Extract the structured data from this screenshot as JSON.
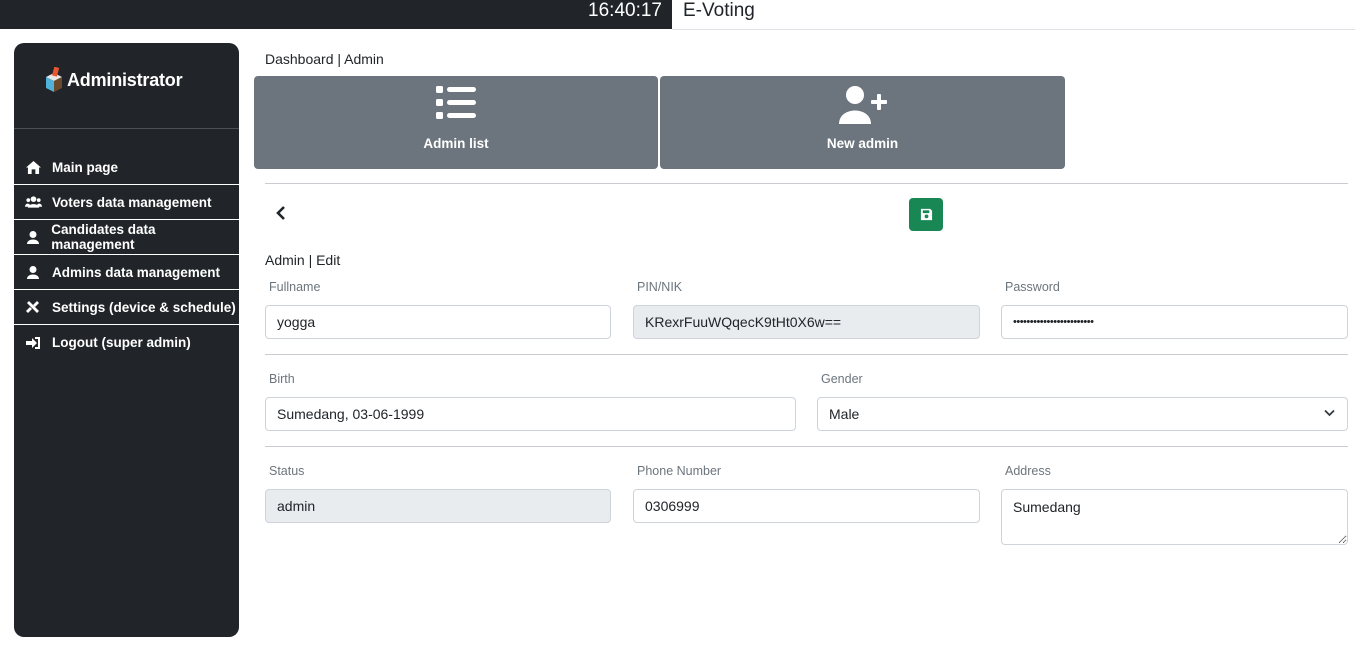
{
  "topbar": {
    "clock": "16:40:17",
    "app_title": "E-Voting"
  },
  "sidebar": {
    "brand": "Administrator",
    "items": [
      {
        "label": "Main page",
        "icon": "home-icon"
      },
      {
        "label": "Voters data management",
        "icon": "users-icon"
      },
      {
        "label": "Candidates data management",
        "icon": "user-icon"
      },
      {
        "label": "Admins data management",
        "icon": "user-icon"
      },
      {
        "label": "Settings (device & schedule)",
        "icon": "tools-icon"
      },
      {
        "label": "Logout (super admin)",
        "icon": "logout-icon"
      }
    ]
  },
  "breadcrumb": "Dashboard | Admin",
  "tiles": [
    {
      "label": "Admin list",
      "icon": "list-icon"
    },
    {
      "label": "New admin",
      "icon": "user-plus-icon"
    }
  ],
  "form": {
    "title": "Admin | Edit",
    "fullname": {
      "label": "Fullname",
      "value": "yogga"
    },
    "pin": {
      "label": "PIN/NIK",
      "value": "KRexrFuuWQqecK9tHt0X6w=="
    },
    "password": {
      "label": "Password",
      "value": "••••••••••••••••••••••••"
    },
    "birth": {
      "label": "Birth",
      "value": "Sumedang, 03-06-1999"
    },
    "gender": {
      "label": "Gender",
      "value": "Male"
    },
    "status": {
      "label": "Status",
      "value": "admin"
    },
    "phone": {
      "label": "Phone Number",
      "value": "0306999"
    },
    "address": {
      "label": "Address",
      "value": "Sumedang"
    }
  },
  "colors": {
    "sidebar_bg": "#212529",
    "tile_bg": "#6c757d",
    "save_button": "#198754",
    "readonly_bg": "#e9ecef"
  }
}
